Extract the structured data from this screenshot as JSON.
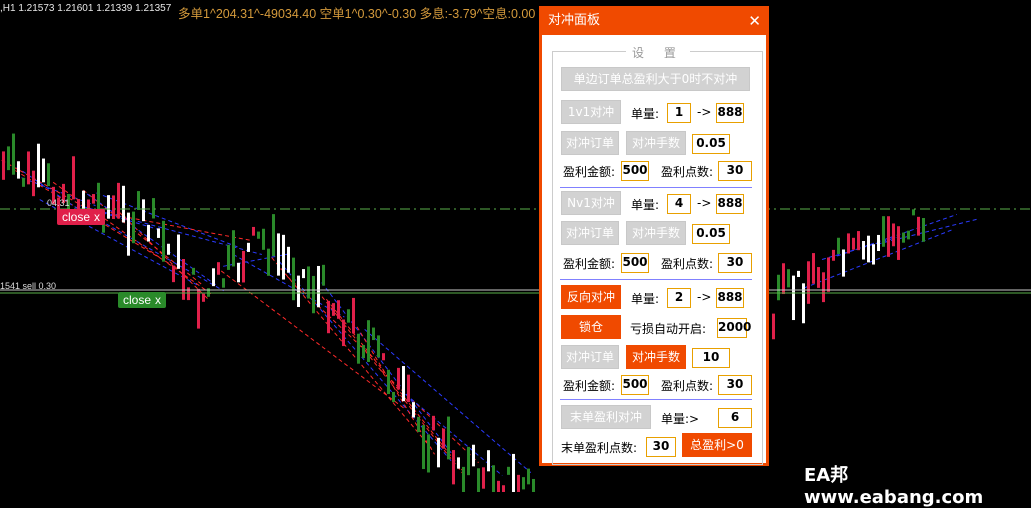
{
  "chart_header": {
    "symbol_line": ",H1  1.21573 1.21601 1.21339 1.21357",
    "stats_line": "多单1^204.31^-49034.40   空单1^0.30^-0.30   多息:-3.79^空息:0.00"
  },
  "chart_labels": {
    "level_a": "04.31",
    "level_b": "1541 sell 0.30",
    "close_red": "close",
    "close_green": "close",
    "close_x": "x"
  },
  "colors": {
    "accent": "#f04a00",
    "bear": "#e0204a",
    "bull": "#2a8a2a",
    "mid_line": "#5ab04a"
  },
  "panel": {
    "title": "对冲面板",
    "close_icon": "✕",
    "settings_label": "设 置",
    "btn_no_hedge": "单边订单总盈利大于0时不对冲",
    "s1": {
      "mode_btn": "1v1对冲",
      "lot_label": "单量:",
      "lot_min": "1",
      "arrow": "->",
      "lot_max": "888",
      "hedge_order_btn": "对冲订单",
      "hedge_lots_btn": "对冲手数",
      "hedge_lots_val": "0.05",
      "profit_amt_label": "盈利金额:",
      "profit_amt": "500",
      "profit_pts_label": "盈利点数:",
      "profit_pts": "30"
    },
    "s2": {
      "mode_btn": "Nv1对冲",
      "lot_label": "单量:",
      "lot_min": "4",
      "arrow": "->",
      "lot_max": "888",
      "hedge_order_btn": "对冲订单",
      "hedge_lots_btn": "对冲手数",
      "hedge_lots_val": "0.05",
      "profit_amt_label": "盈利金额:",
      "profit_amt": "500",
      "profit_pts_label": "盈利点数:",
      "profit_pts": "30"
    },
    "s3": {
      "mode_btn": "反向对冲",
      "lot_label": "单量:",
      "lot_min": "2",
      "arrow": "->",
      "lot_max": "888",
      "lock_btn": "锁仓",
      "loss_label": "亏损自动开启:",
      "loss_val": "2000",
      "hedge_order_btn": "对冲订单",
      "hedge_lots_btn": "对冲手数",
      "hedge_lots_val": "10",
      "profit_amt_label": "盈利金额:",
      "profit_amt": "500",
      "profit_pts_label": "盈利点数:",
      "profit_pts": "30"
    },
    "s4": {
      "last_btn": "末单盈利对冲",
      "lot_label": "单量:>",
      "lot_val": "6",
      "pts_label": "末单盈利点数:",
      "pts_val": "30",
      "total_btn": "总盈利>0"
    }
  },
  "watermark": "EA邦www.eabang.com"
}
